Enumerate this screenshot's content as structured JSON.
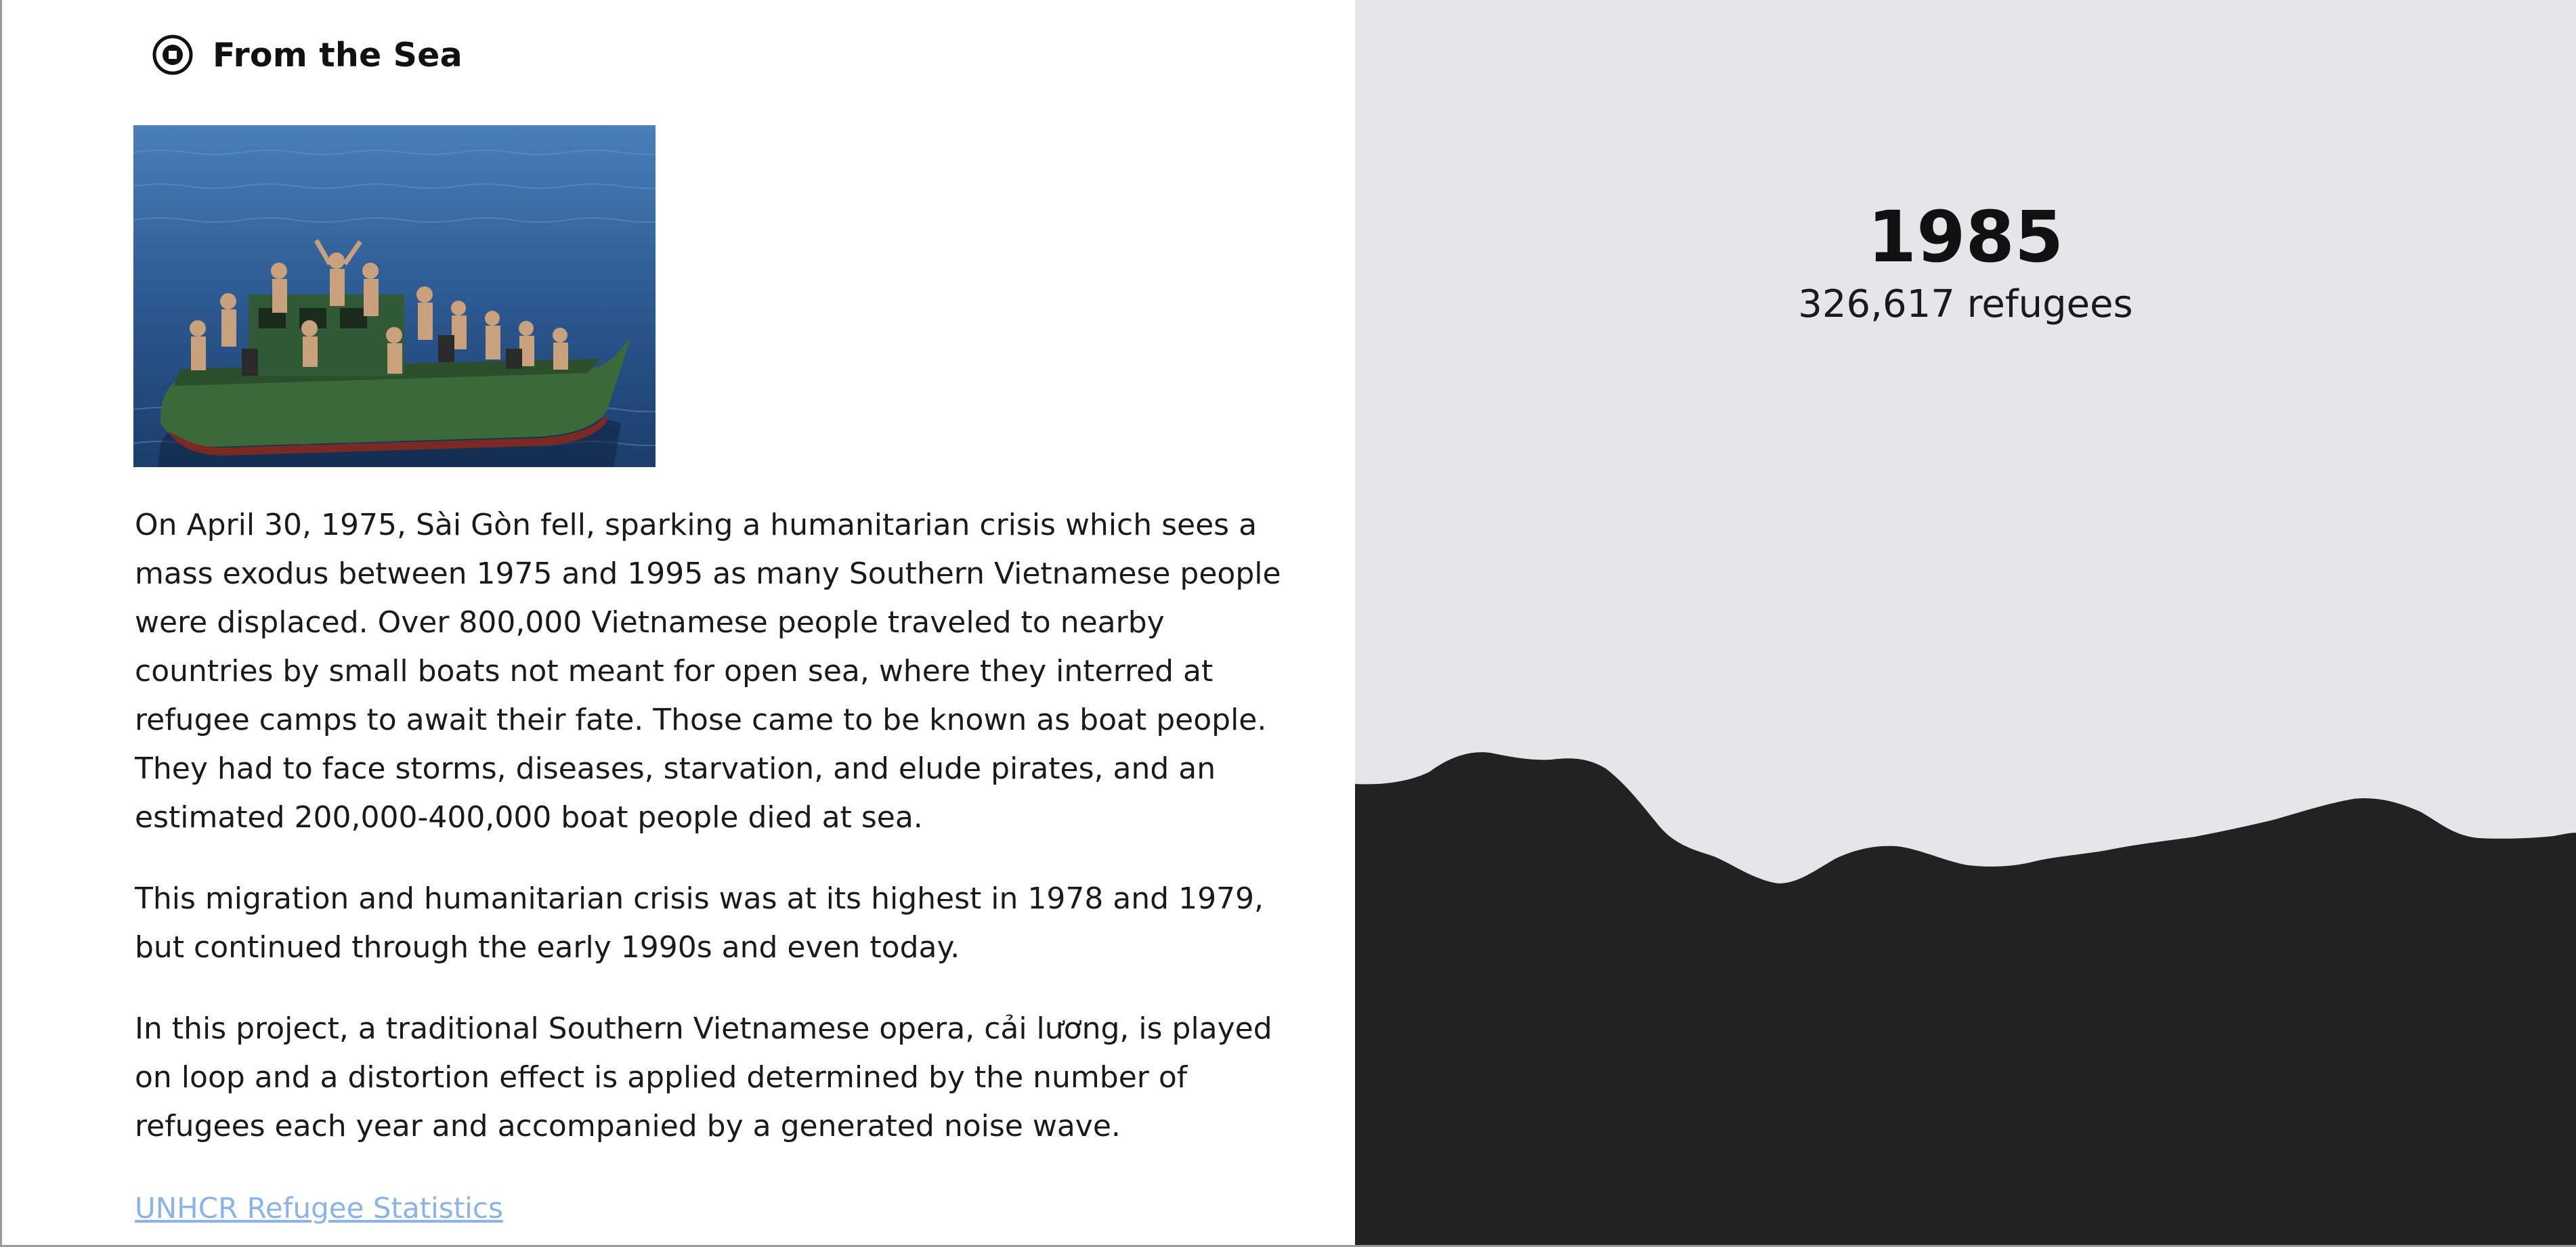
{
  "header": {
    "logo_icon": "circle-target-icon",
    "title": "From the Sea"
  },
  "photo": {
    "icon": "boat-photo"
  },
  "body": {
    "paragraphs": [
      "On April 30, 1975, Sài Gòn fell, sparking a humanitarian crisis which sees a mass exodus between 1975 and 1995 as many Southern Vietnamese people were displaced. Over 800,000 Vietnamese people traveled to nearby countries by small boats not meant for open sea, where they interred at refugee camps to await their fate. Those came to be known as boat people. They had to face storms, diseases, starvation, and elude pirates, and an estimated 200,000-400,000 boat people died at sea.",
      "This migration and humanitarian crisis was at its highest in 1978 and 1979, but continued through the early 1990s and even today.",
      "In this project, a traditional Southern Vietnamese opera, cải lương, is played on loop and a distortion effect is applied determined by the number of refugees each year and accompanied by a generated noise wave."
    ]
  },
  "link": {
    "label": "UNHCR Refugee Statistics"
  },
  "visual": {
    "year": "1985",
    "refugees_label": "326,617 refugees",
    "background_color": "#e6e6e9",
    "wave_color": "#222222"
  },
  "colors": {
    "link": "#8ab4e8",
    "text": "#1a1a1a"
  }
}
